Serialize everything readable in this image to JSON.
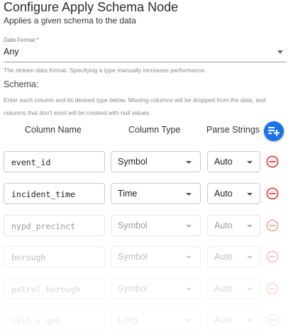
{
  "header": {
    "title": "Configure Apply Schema Node",
    "subtitle": "Applies a given schema to the data"
  },
  "data_format": {
    "label": "Data Format *",
    "value": "Any",
    "helper": "The stream data format. Specifying a type manually increases performance."
  },
  "schema": {
    "label": "Schema:",
    "helper": "Enter each column and its desired type below. Missing columns will be dropped from the data, and columns that don't exist will be created with null values.",
    "columns": {
      "name": "Column Name",
      "type": "Column Type",
      "parse": "Parse Strings"
    },
    "rows": [
      {
        "name": "event_id",
        "type": "Symbol",
        "parse": "Auto"
      },
      {
        "name": "incident_time",
        "type": "Time",
        "parse": "Auto"
      },
      {
        "name": "nypd_precinct",
        "type": "Symbol",
        "parse": "Auto"
      },
      {
        "name": "borough",
        "type": "Symbol",
        "parse": "Auto"
      },
      {
        "name": "patrol_borough",
        "type": "Symbol",
        "parse": "Auto"
      },
      {
        "name": "call_x_geo",
        "type": "Long",
        "parse": "Auto"
      }
    ]
  },
  "colors": {
    "accent": "#1a73e8",
    "remove": "#e53935"
  },
  "icons": {
    "add": "playlist-add-icon",
    "remove": "remove-circle-icon",
    "dropdown": "caret-down-icon"
  }
}
